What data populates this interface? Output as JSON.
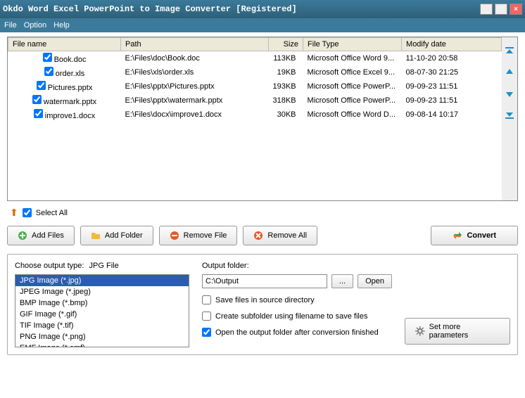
{
  "title": "Okdo Word Excel PowerPoint to Image Converter [Registered]",
  "menu": {
    "file": "File",
    "option": "Option",
    "help": "Help"
  },
  "columns": {
    "name": "File name",
    "path": "Path",
    "size": "Size",
    "type": "File Type",
    "date": "Modify date"
  },
  "files": [
    {
      "checked": true,
      "name": "Book.doc",
      "path": "E:\\Files\\doc\\Book.doc",
      "size": "113KB",
      "type": "Microsoft Office Word 9...",
      "date": "11-10-20 20:58"
    },
    {
      "checked": true,
      "name": "order.xls",
      "path": "E:\\Files\\xls\\order.xls",
      "size": "19KB",
      "type": "Microsoft Office Excel 9...",
      "date": "08-07-30 21:25"
    },
    {
      "checked": true,
      "name": "Pictures.pptx",
      "path": "E:\\Files\\pptx\\Pictures.pptx",
      "size": "193KB",
      "type": "Microsoft Office PowerP...",
      "date": "09-09-23 11:51"
    },
    {
      "checked": true,
      "name": "watermark.pptx",
      "path": "E:\\Files\\pptx\\watermark.pptx",
      "size": "318KB",
      "type": "Microsoft Office PowerP...",
      "date": "09-09-23 11:51"
    },
    {
      "checked": true,
      "name": "improve1.docx",
      "path": "E:\\Files\\docx\\improve1.docx",
      "size": "30KB",
      "type": "Microsoft Office Word D...",
      "date": "09-08-14 10:17"
    }
  ],
  "select_all": {
    "checked": true,
    "label": "Select All"
  },
  "buttons": {
    "add_files": "Add Files",
    "add_folder": "Add Folder",
    "remove_file": "Remove File",
    "remove_all": "Remove All",
    "convert": "Convert"
  },
  "output_type": {
    "label": "Choose output type:",
    "current": "JPG File",
    "options": [
      "JPG Image (*.jpg)",
      "JPEG Image (*.jpeg)",
      "BMP Image (*.bmp)",
      "GIF Image (*.gif)",
      "TIF Image (*.tif)",
      "PNG Image (*.png)",
      "EMF Image (*.emf)"
    ],
    "selected_index": 0
  },
  "output": {
    "label": "Output folder:",
    "value": "C:\\Output",
    "browse": "...",
    "open": "Open",
    "save_source": {
      "checked": false,
      "label": "Save files in source directory"
    },
    "subfolder": {
      "checked": false,
      "label": "Create subfolder using filename to save files"
    },
    "open_after": {
      "checked": true,
      "label": "Open the output folder after conversion finished"
    },
    "more_params": "Set more parameters"
  }
}
